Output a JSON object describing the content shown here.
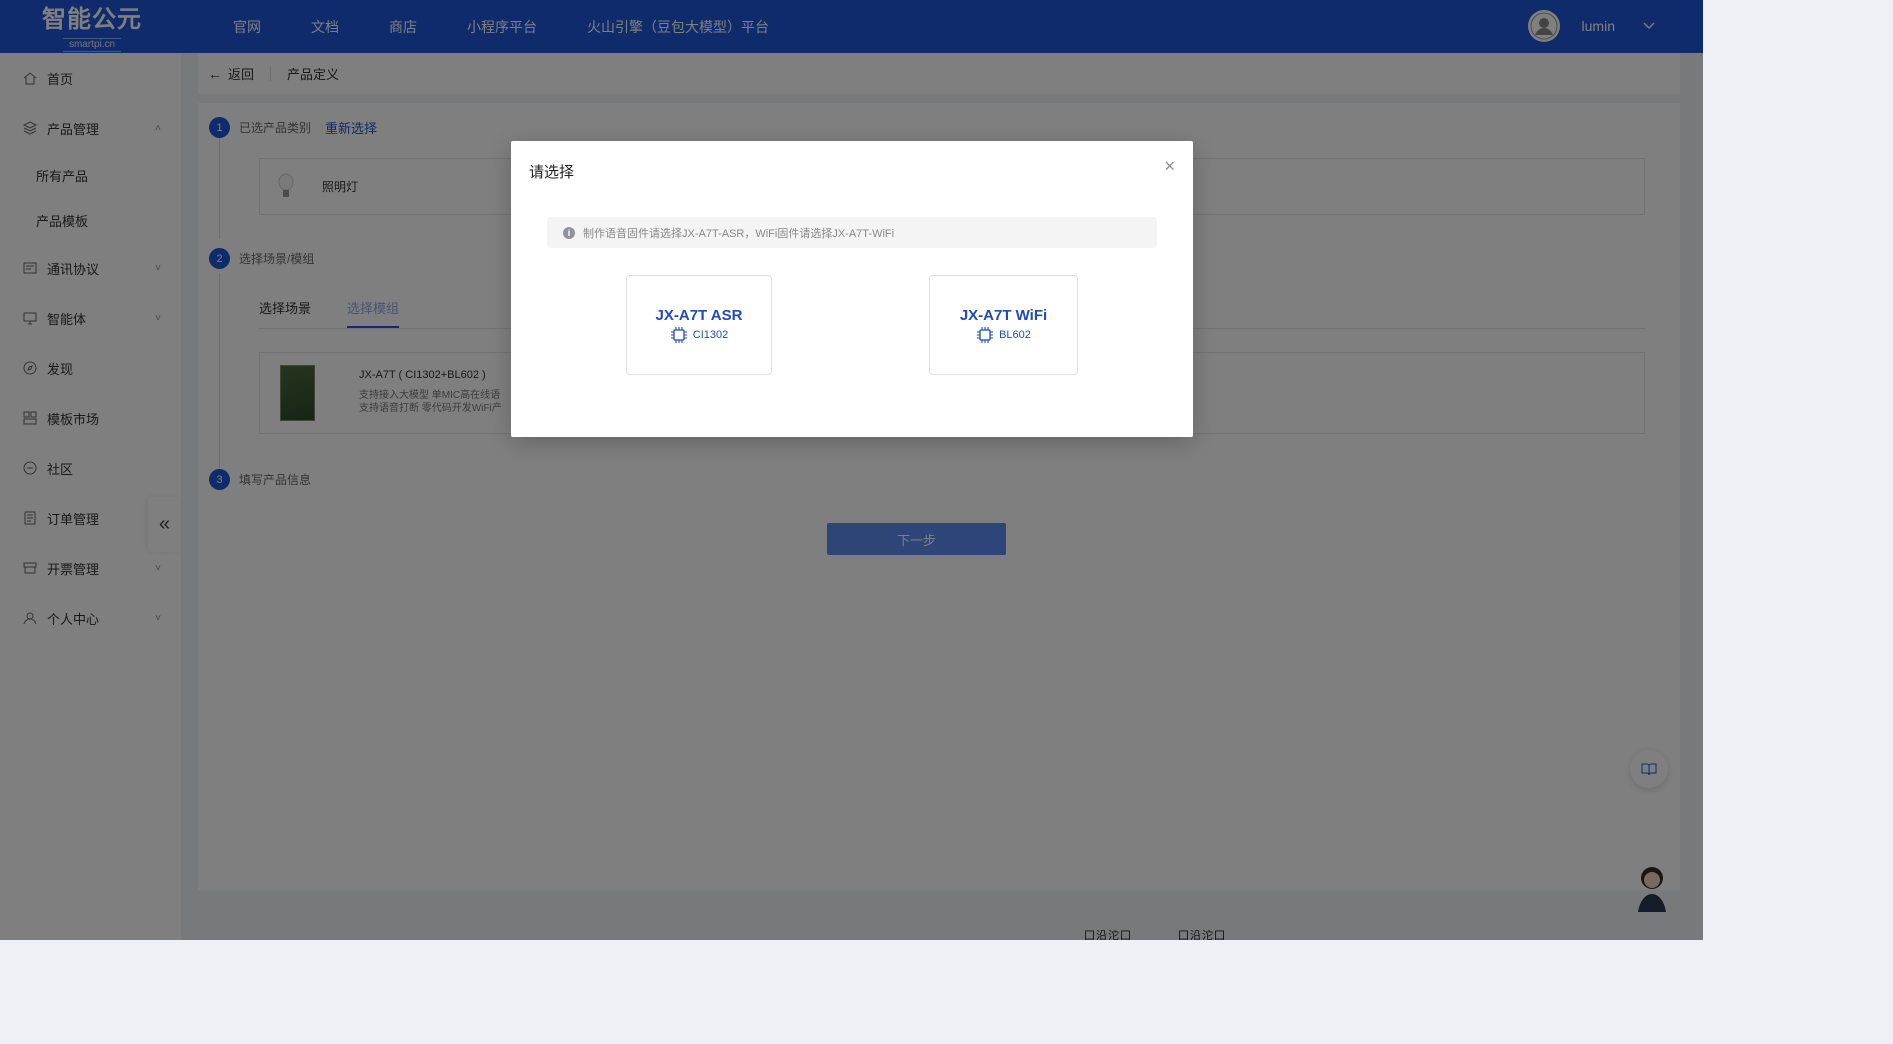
{
  "header": {
    "logo_main": "智能公元",
    "logo_sub": "smartpi.cn",
    "nav": [
      "官网",
      "文档",
      "商店",
      "小程序平台",
      "火山引擎（豆包大模型）平台"
    ],
    "username": "lumin"
  },
  "sidebar": {
    "items": [
      {
        "label": "首页",
        "icon": "home-icon"
      },
      {
        "label": "产品管理",
        "icon": "layers-icon",
        "expanded": true,
        "children": [
          "所有产品",
          "产品模板"
        ]
      },
      {
        "label": "通讯协议",
        "icon": "protocol-icon"
      },
      {
        "label": "智能体",
        "icon": "monitor-icon"
      },
      {
        "label": "发现",
        "icon": "compass-icon"
      },
      {
        "label": "模板市场",
        "icon": "template-icon"
      },
      {
        "label": "社区",
        "icon": "community-icon"
      },
      {
        "label": "订单管理",
        "icon": "order-icon"
      },
      {
        "label": "开票管理",
        "icon": "invoice-icon"
      },
      {
        "label": "个人中心",
        "icon": "user-icon"
      }
    ]
  },
  "breadcrumb": {
    "back_label": "返回",
    "current": "产品定义"
  },
  "steps": {
    "step1_num": "1",
    "step1_label": "已选产品类别",
    "reselect_label": "重新选择",
    "category_name": "照明灯",
    "step2_num": "2",
    "step2_label": "选择场景/模组",
    "tab_scene": "选择场景",
    "tab_module": "选择模组",
    "module_title": "JX-A7T ( CI1302+BL602 )",
    "module_desc_1": "支持接入大模型 单MIC高在线语",
    "module_desc_2": "支持语音打断 零代码开发WiFi产",
    "step3_num": "3",
    "step3_label": "填写产品信息",
    "next_label": "下一步"
  },
  "footer": {
    "qr1": "囗沿沱囗",
    "qr2": "囗沿沱囗"
  },
  "modal": {
    "title": "请选择",
    "notice": "制作语音固件请选择JX-A7T-ASR，WiFi固件请选择JX-A7T-WiFi",
    "choices": [
      {
        "name": "JX-A7T ASR",
        "chip": "CI1302"
      },
      {
        "name": "JX-A7T WiFi",
        "chip": "BL602"
      }
    ]
  },
  "colors": {
    "brand": "#1f56d8",
    "choice_text": "#1f4ab8",
    "mask": "rgba(0,0,0,0.5)"
  }
}
